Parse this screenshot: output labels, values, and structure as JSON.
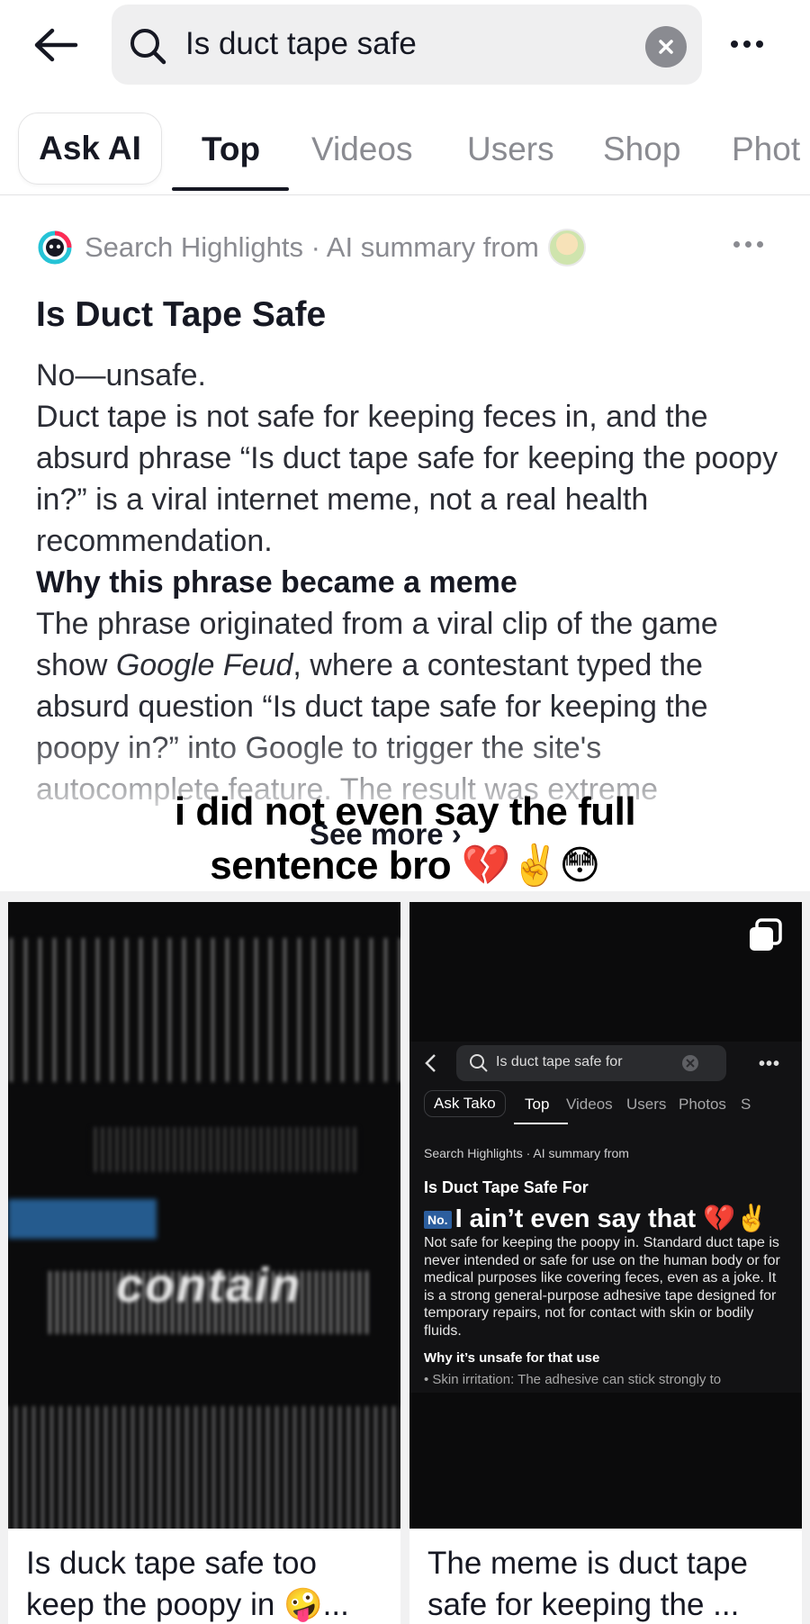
{
  "search": {
    "query": "Is duct tape safe"
  },
  "tabs": [
    "Ask AI",
    "Top",
    "Videos",
    "Users",
    "Shop",
    "Phot"
  ],
  "summary": {
    "source_line": "Search Highlights · AI summary from",
    "title": "Is Duct Tape Safe",
    "answer": "No—unsafe.",
    "para1": "Duct tape is not safe for keeping feces in, and the absurd phrase “Is duct tape safe for keeping the poopy in?” is a viral internet meme, not a real health recommendation.",
    "heading": "Why this phrase became a meme",
    "para2_pre": "The phrase originated from a viral clip of the game show ",
    "para2_italic": "Google Feud",
    "para2_post": ", where a contestant typed the absurd question “Is duct tape safe for keeping the poopy in?” into Google to trigger the site's autocomplete feature. The result was extreme",
    "see_more": "See more",
    "caption_line1": "i did not even say the full",
    "caption_line2": "sentence bro 💔✌️😳"
  },
  "cards": [
    {
      "title": "Is duck tape safe too keep the poopy in 🤪...",
      "thumb_text": "contain"
    },
    {
      "title": "The meme is duct tape safe for keeping the ...",
      "mini": {
        "search": "Is duct tape safe for",
        "tabs": [
          "Ask Tako",
          "Top",
          "Videos",
          "Users",
          "Photos",
          "S"
        ],
        "highlights": "Search Highlights · AI summary from",
        "title": "Is Duct Tape Safe For",
        "no_badge": "No.",
        "overlay": "I ain’t even say that 💔✌️",
        "body": "Not safe for keeping the poopy in. Standard duct tape is never intended or safe for use on the human body or for medical purposes like covering feces, even as a joke. It is a strong general-purpose adhesive tape designed for temporary repairs, not for contact with skin or bodily fluids.",
        "heading": "Why it’s unsafe for that use",
        "bullet": "• Skin irritation: The adhesive can stick strongly to"
      }
    }
  ]
}
